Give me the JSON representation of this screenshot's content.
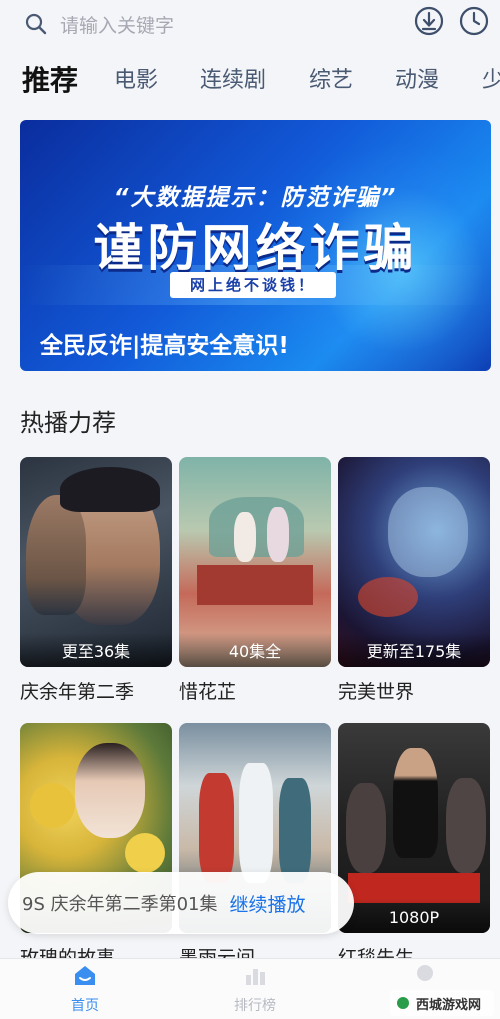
{
  "search": {
    "placeholder": "请输入关键字",
    "icon": "search-icon"
  },
  "toolbar": {
    "download_icon": "download-icon",
    "history_icon": "history-clock-icon"
  },
  "tabs": [
    {
      "label": "推荐",
      "active": true
    },
    {
      "label": "电影"
    },
    {
      "label": "连续剧"
    },
    {
      "label": "综艺"
    },
    {
      "label": "动漫"
    },
    {
      "label": "少"
    }
  ],
  "banner": {
    "subtitle": "“大数据提示：防范诈骗”",
    "title": "谨防网络诈骗",
    "pill": "网上绝不谈钱！",
    "caption": "全民反诈|提高安全意识!"
  },
  "section": {
    "title": "热播力荐"
  },
  "cards": [
    {
      "title": "庆余年第二季",
      "badge": "更至36集"
    },
    {
      "title": "惜花芷",
      "badge": "40集全"
    },
    {
      "title": "完美世界",
      "badge": "更新至175集"
    },
    {
      "title": "玫瑰的故事",
      "badge": ""
    },
    {
      "title": "墨雨云间",
      "badge": ""
    },
    {
      "title": "红毯先生",
      "badge": "1080P"
    }
  ],
  "continue_watching": {
    "progress_text": "9S 庆余年第二季第01集",
    "action": "继续播放"
  },
  "bottom_nav": [
    {
      "label": "首页",
      "active": true,
      "icon": "home-icon"
    },
    {
      "label": "排行榜",
      "active": false,
      "icon": "ranking-icon"
    },
    {
      "label": "",
      "active": false,
      "icon": "profile-icon"
    }
  ],
  "watermark": {
    "text": "西城游戏网"
  },
  "colors": {
    "accent": "#1a73e8",
    "banner_blue": "#1259d8",
    "tab_inactive": "#4a5a73"
  }
}
